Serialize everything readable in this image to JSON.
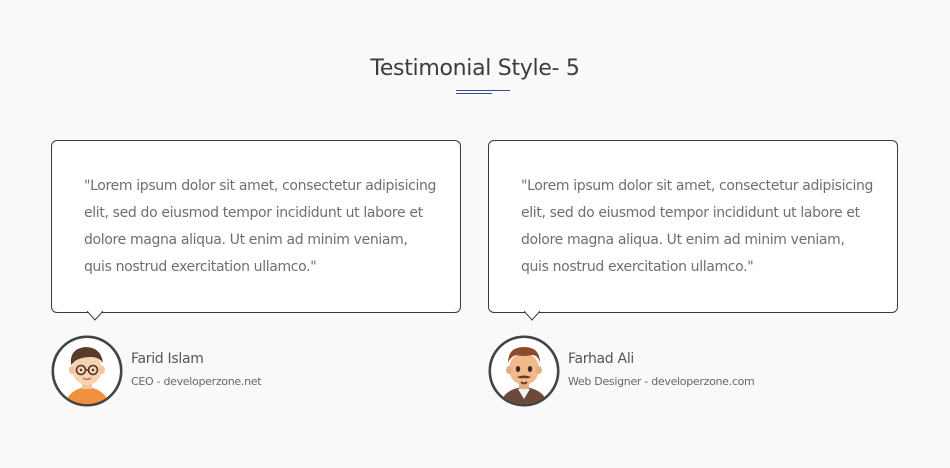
{
  "section": {
    "title": "Testimonial Style- 5"
  },
  "testimonials": [
    {
      "quote": "\"Lorem ipsum dolor sit amet, consectetur adipisicing elit, sed do eiusmod tempor incididunt ut labore et dolore magna aliqua. Ut enim ad minim veniam, quis nostrud exercitation ullamco.\"",
      "name": "Farid Islam",
      "role": "CEO - developerzone.net",
      "avatar_icon": "man-with-glasses-avatar-icon"
    },
    {
      "quote": "\"Lorem ipsum dolor sit amet, consectetur adipisicing elit, sed do eiusmod tempor incididunt ut labore et dolore magna aliqua. Ut enim ad minim veniam, quis nostrud exercitation ullamco.\"",
      "name": "Farhad Ali",
      "role": "Web Designer - developerzone.com",
      "avatar_icon": "man-with-beard-avatar-icon"
    }
  ],
  "colors": {
    "background": "#f9f9f9",
    "accent_rule": "#3b4a8a",
    "card_border": "#3a3a3a",
    "quote_text": "#6f6f6f"
  }
}
